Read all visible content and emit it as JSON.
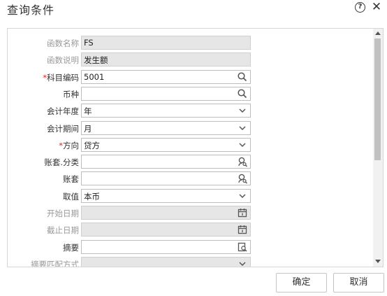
{
  "dialog": {
    "title": "查询条件",
    "help_icon": "help-circle-icon",
    "close_icon": "close-icon",
    "close_glyph": "✕",
    "help_glyph": "?"
  },
  "form": {
    "fields": [
      {
        "label": "函数名称",
        "value": "FS",
        "type": "text",
        "disabled": true,
        "required": false,
        "icon": "none"
      },
      {
        "label": "函数说明",
        "value": "发生额",
        "type": "text",
        "disabled": true,
        "required": false,
        "icon": "none"
      },
      {
        "label": "科目编码",
        "value": "5001",
        "type": "search",
        "disabled": false,
        "required": true,
        "icon": "search-icon"
      },
      {
        "label": "币种",
        "value": "",
        "type": "search",
        "disabled": false,
        "required": false,
        "icon": "search-icon"
      },
      {
        "label": "会计年度",
        "value": "年",
        "type": "select",
        "disabled": false,
        "required": false,
        "icon": "chevron-down-icon"
      },
      {
        "label": "会计期间",
        "value": "月",
        "type": "select",
        "disabled": false,
        "required": false,
        "icon": "chevron-down-icon"
      },
      {
        "label": "方向",
        "value": "贷方",
        "type": "select",
        "disabled": false,
        "required": true,
        "icon": "chevron-down-icon"
      },
      {
        "label": "账套.分类",
        "value": "",
        "type": "lookup",
        "disabled": false,
        "required": false,
        "icon": "user-search-icon"
      },
      {
        "label": "账套",
        "value": "",
        "type": "lookup",
        "disabled": false,
        "required": false,
        "icon": "user-search-icon"
      },
      {
        "label": "取值",
        "value": "本币",
        "type": "select",
        "disabled": false,
        "required": false,
        "icon": "chevron-down-icon"
      },
      {
        "label": "开始日期",
        "value": "",
        "type": "date",
        "disabled": true,
        "required": false,
        "icon": "calendar-icon"
      },
      {
        "label": "截止日期",
        "value": "",
        "type": "date",
        "disabled": true,
        "required": false,
        "icon": "calendar-icon"
      },
      {
        "label": "摘要",
        "value": "",
        "type": "picker",
        "disabled": false,
        "required": false,
        "icon": "document-search-icon"
      },
      {
        "label": "摘要匹配方式",
        "value": "",
        "type": "select",
        "disabled": true,
        "required": false,
        "icon": "chevron-down-icon"
      }
    ],
    "required_mark": "*"
  },
  "buttons": {
    "ok_label": "确定",
    "cancel_label": "取消"
  },
  "colors": {
    "required": "#e02020",
    "disabled_bg": "#e6e6e6",
    "border": "#bdbdbd"
  }
}
